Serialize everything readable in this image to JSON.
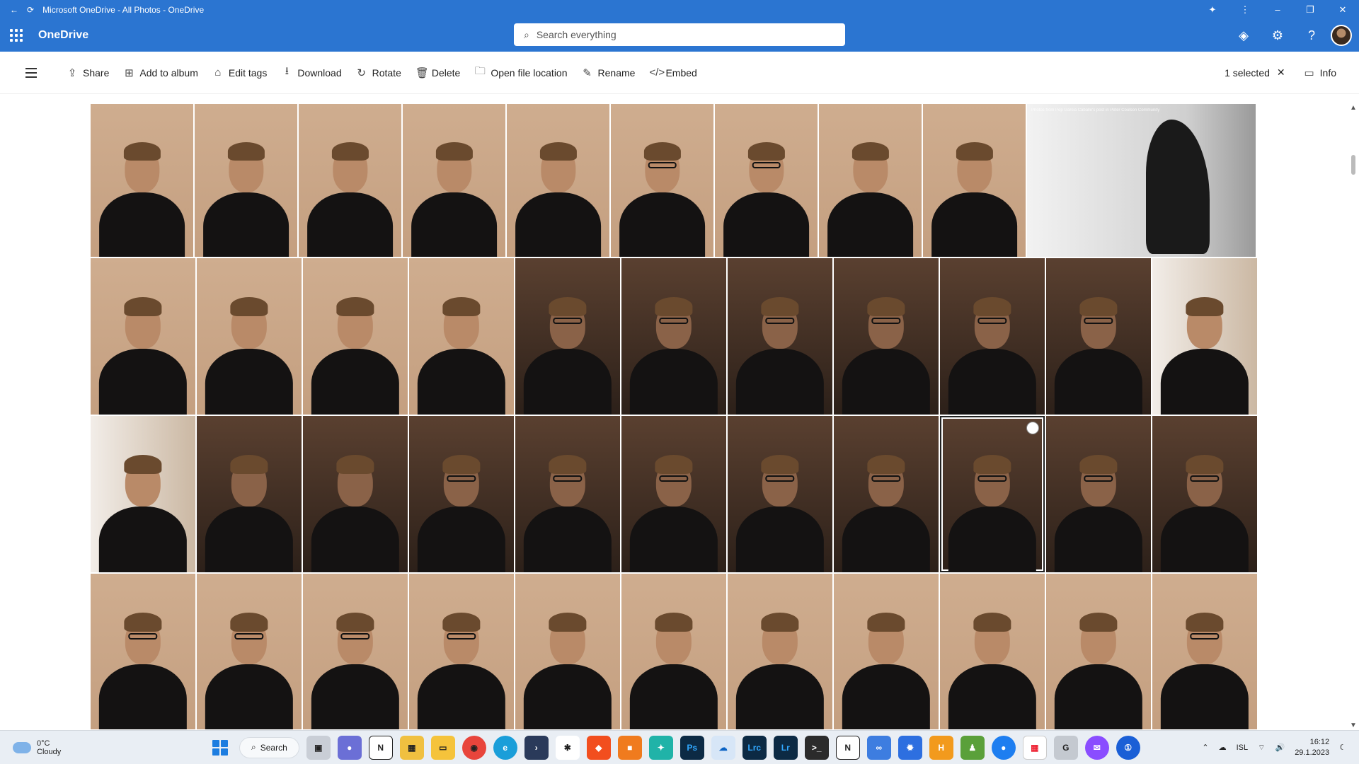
{
  "window": {
    "title": "Microsoft OneDrive - All Photos - OneDrive",
    "controls": {
      "minimize": "–",
      "restore": "❐",
      "close": "✕"
    }
  },
  "app": {
    "brand": "OneDrive",
    "search_placeholder": "Search everything",
    "accent_color": "#2b75d1"
  },
  "commands": [
    {
      "label": "Share",
      "icon": "share-icon",
      "glyph": "⇪"
    },
    {
      "label": "Add to album",
      "icon": "album-icon",
      "glyph": "⊞"
    },
    {
      "label": "Edit tags",
      "icon": "tag-icon",
      "glyph": "⌂"
    },
    {
      "label": "Download",
      "icon": "download-icon",
      "glyph": "⭳"
    },
    {
      "label": "Rotate",
      "icon": "rotate-icon",
      "glyph": "↻"
    },
    {
      "label": "Delete",
      "icon": "trash-icon",
      "glyph": "🗑"
    },
    {
      "label": "Open file location",
      "icon": "folder-icon",
      "glyph": "🗀"
    },
    {
      "label": "Rename",
      "icon": "pencil-icon",
      "glyph": "✎"
    },
    {
      "label": "Embed",
      "icon": "code-icon",
      "glyph": "</>"
    }
  ],
  "selection": {
    "label": "1 selected",
    "info_label": "Info"
  },
  "photo_card": {
    "caption": "Photos from Pep Garcia Caballe's post in Peter Coulson Community"
  },
  "taskbar": {
    "weather_temp": "0°C",
    "weather_desc": "Cloudy",
    "search_label": "Search",
    "language": "ISL",
    "time": "16:12",
    "date": "29.1.2023"
  }
}
